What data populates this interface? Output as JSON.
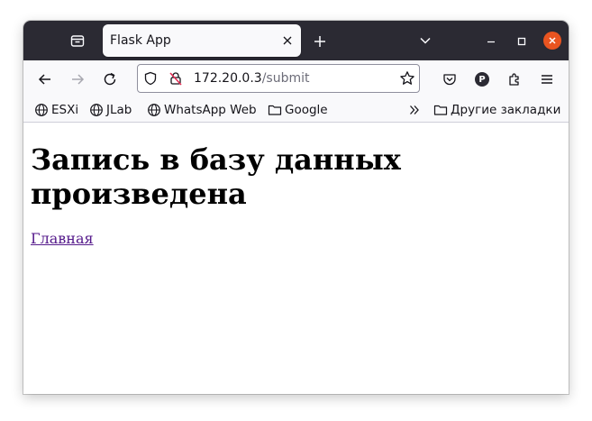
{
  "browser": {
    "tab": {
      "title": "Flask App"
    },
    "url": {
      "host": "172.20.0.3",
      "path": "/submit"
    },
    "bookmarks": [
      {
        "label": "ESXi",
        "icon": "globe-icon"
      },
      {
        "label": "JLab",
        "icon": "globe-icon"
      },
      {
        "label": "WhatsApp Web",
        "icon": "globe-icon"
      },
      {
        "label": "Google",
        "icon": "folder-icon"
      }
    ],
    "other_bookmarks": {
      "label": "Другие закладки",
      "icon": "folder-icon"
    },
    "profile_initial": "P",
    "colors": {
      "titlebar": "#2b2a33",
      "toolbar": "#f9f9fb",
      "close": "#e95420",
      "visited_link": "#551a8b"
    }
  },
  "page": {
    "heading": "Запись в базу данных произведена",
    "link": "Главная"
  }
}
